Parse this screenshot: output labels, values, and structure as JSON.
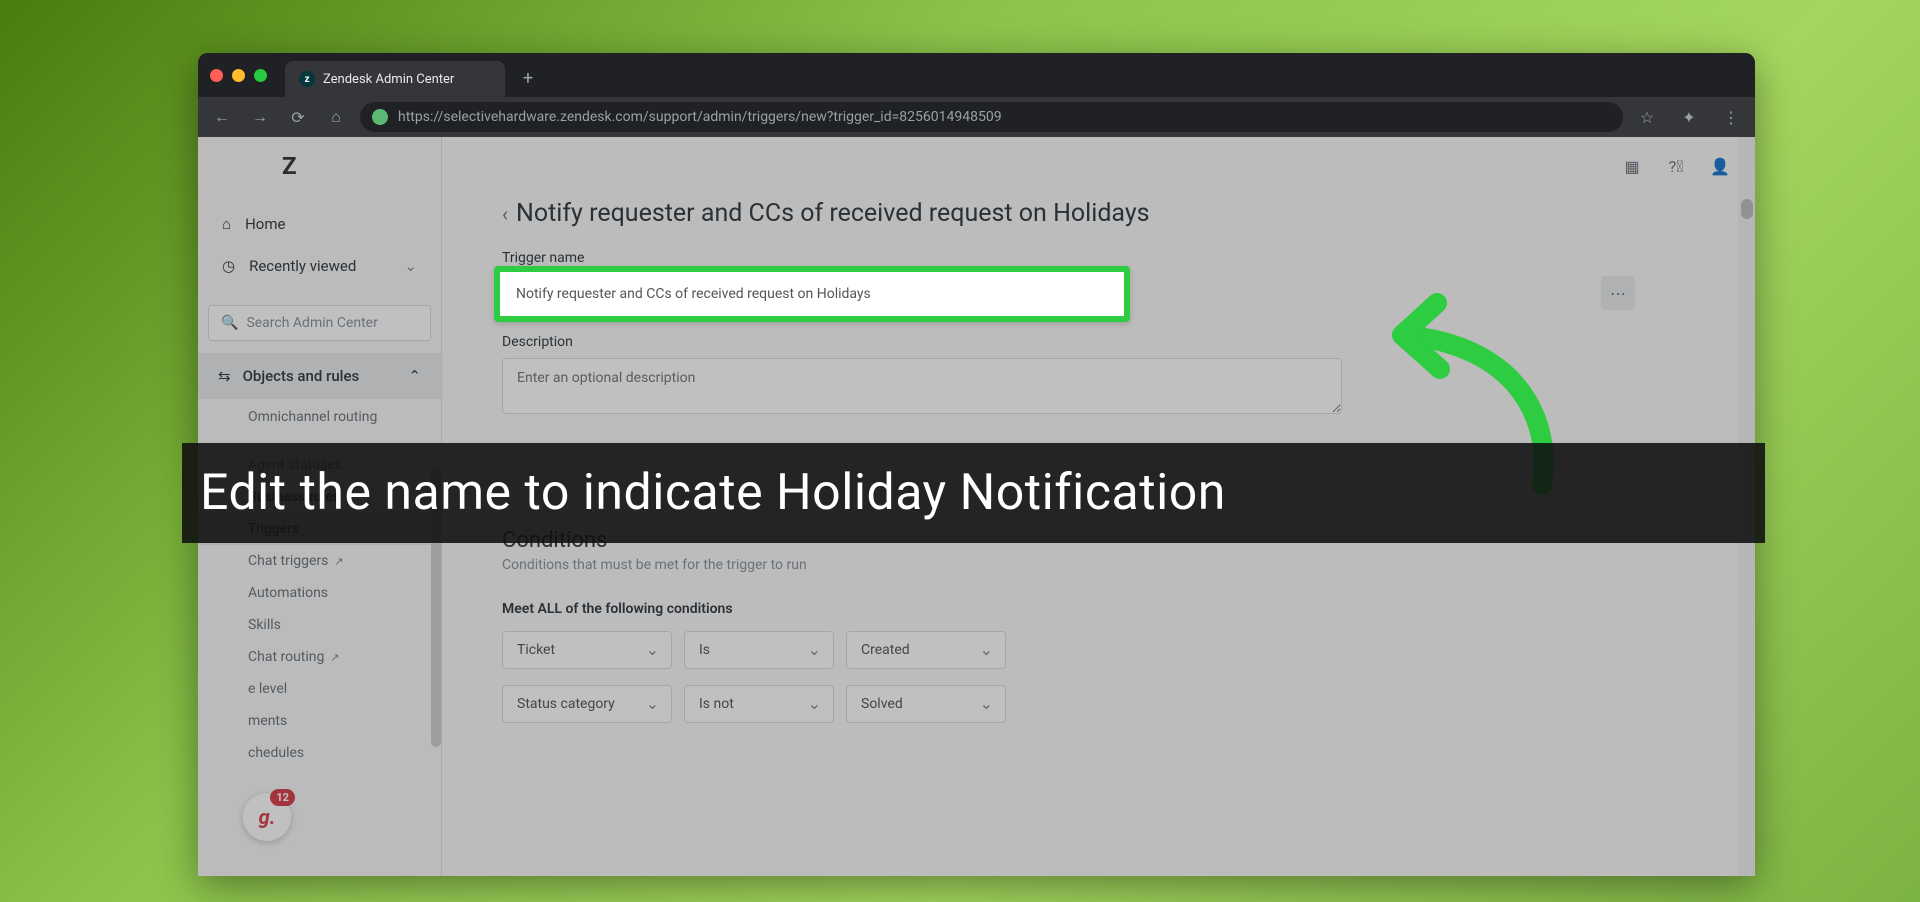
{
  "browser": {
    "tab_title": "Zendesk Admin Center",
    "url": "https://selectivehardware.zendesk.com/support/admin/triggers/new?trigger_id=8256014948509"
  },
  "sidebar": {
    "logo": "Z",
    "home": "Home",
    "recently_viewed": "Recently viewed",
    "search_placeholder": "Search Admin Center",
    "section": "Objects and rules",
    "items": [
      "Omnichannel routing",
      "",
      "Agent statuses"
    ],
    "group_header": "Business rules",
    "rules": {
      "triggers": "Triggers",
      "chat_triggers": "Chat triggers",
      "automations": "Automations",
      "skills": "Skills",
      "chat_routing": "Chat routing",
      "service_level_a": "e level",
      "service_level_b": "ments",
      "schedules": "chedules"
    },
    "badge_count": "12",
    "badge_letter": "g."
  },
  "page": {
    "breadcrumb": "Notify requester and CCs of received request on Holidays",
    "trigger_name_label": "Trigger name",
    "trigger_name_value": "Notify requester and CCs of received request on Holidays",
    "description_label": "Description",
    "description_placeholder": "Enter an optional description",
    "conditions_title": "Conditions",
    "conditions_sub": "Conditions that must be met for the trigger to run",
    "meet_all_label": "Meet ALL of the following conditions",
    "cond1": {
      "a": "Ticket",
      "b": "Is",
      "c": "Created"
    },
    "cond2": {
      "a": "Status category",
      "b": "Is not",
      "c": "Solved"
    }
  },
  "instruction": "Edit the name to indicate  Holiday Notification"
}
